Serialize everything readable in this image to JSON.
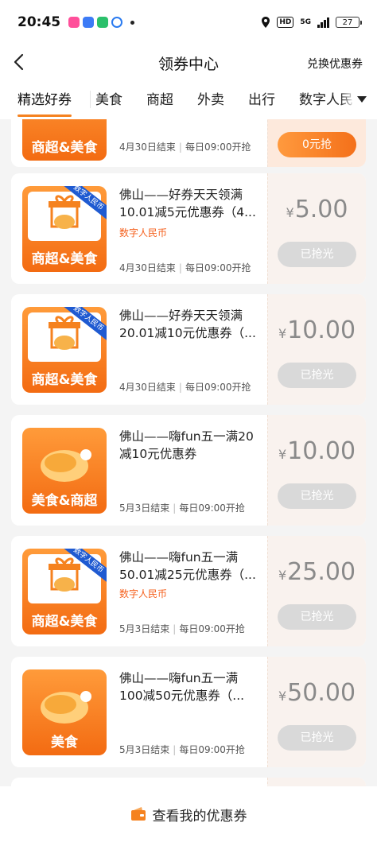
{
  "status": {
    "time": "20:45",
    "battery": "27",
    "network": "5G",
    "hd": "HD"
  },
  "nav": {
    "title": "领券中心",
    "exchange": "兑换优惠券"
  },
  "tabs": [
    {
      "label": "精选好券",
      "active": true
    },
    {
      "label": "美食"
    },
    {
      "label": "商超"
    },
    {
      "label": "外卖"
    },
    {
      "label": "出行"
    },
    {
      "label": "数字人民"
    }
  ],
  "coupons": [
    {
      "thumb_label": "商超&美食",
      "ribbon": "",
      "title": "",
      "subtag": "",
      "meta_end": "4月30日结束",
      "meta_daily": "每日09:00开抢",
      "price": "",
      "yen": "",
      "button": "0元抢",
      "available": true
    },
    {
      "thumb_label": "商超&美食",
      "ribbon": "数字人民币",
      "title": "佛山——好券天天领满10.01减5元优惠券（4...",
      "subtag": "数字人民币",
      "meta_end": "4月30日结束",
      "meta_daily": "每日09:00开抢",
      "yen": "¥",
      "price": "5.00",
      "button": "已抢光",
      "available": false
    },
    {
      "thumb_label": "商超&美食",
      "ribbon": "数字人民币",
      "title": "佛山——好券天天领满20.01减10元优惠券（...",
      "subtag": "",
      "meta_end": "4月30日结束",
      "meta_daily": "每日09:00开抢",
      "yen": "¥",
      "price": "10.00",
      "button": "已抢光",
      "available": false
    },
    {
      "thumb_label": "美食&商超",
      "ribbon": "",
      "title": "佛山——嗨fun五一满20减10元优惠券",
      "subtag": "",
      "meta_end": "5月3日结束",
      "meta_daily": "每日09:00开抢",
      "yen": "¥",
      "price": "10.00",
      "button": "已抢光",
      "available": false
    },
    {
      "thumb_label": "商超&美食",
      "ribbon": "数字人民币",
      "title": "佛山——嗨fun五一满50.01减25元优惠券（...",
      "subtag": "数字人民币",
      "meta_end": "5月3日结束",
      "meta_daily": "每日09:00开抢",
      "yen": "¥",
      "price": "25.00",
      "button": "已抢光",
      "available": false
    },
    {
      "thumb_label": "美食",
      "ribbon": "",
      "title": "佛山——嗨fun五一满100减50元优惠券（...",
      "subtag": "",
      "meta_end": "5月3日结束",
      "meta_daily": "每日09:00开抢",
      "yen": "¥",
      "price": "50.00",
      "button": "已抢光",
      "available": false
    }
  ],
  "bottom": {
    "label": "查看我的优惠券"
  },
  "colors": {
    "accent": "#f58220",
    "tag": "#f5611e",
    "ribbon": "#1f5ad1"
  }
}
